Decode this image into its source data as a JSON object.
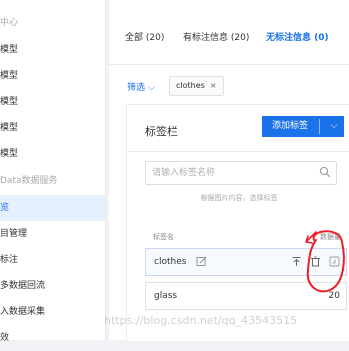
{
  "sidebar": {
    "items": [
      {
        "label": "中心",
        "muted": true
      },
      {
        "label": "模型"
      },
      {
        "label": "模型"
      },
      {
        "label": "模型"
      },
      {
        "label": "模型"
      },
      {
        "label": "模型"
      },
      {
        "label": "Data数据服务",
        "muted": true
      },
      {
        "label": "览",
        "active": true
      },
      {
        "label": "目管理"
      },
      {
        "label": "标注"
      },
      {
        "label": "多数据回流"
      },
      {
        "label": "入数据采集"
      },
      {
        "label": "效"
      }
    ]
  },
  "tabs": [
    {
      "label": "全部 (20)"
    },
    {
      "label": "有标注信息 (20)"
    },
    {
      "label": "无标注信息 (0)",
      "active": true
    }
  ],
  "filter": {
    "toggle_label": "筛选",
    "chip_label": "clothes",
    "chip_close": "×"
  },
  "tag_panel": {
    "title": "标签栏",
    "add_button": "添加标签",
    "add_dropdown": "⌵",
    "search_placeholder": "请输入标签名称",
    "hint": "根据图片内容，选择标签",
    "columns": {
      "name": "标签名",
      "count": "数据量"
    },
    "rows": [
      {
        "name": "clothes",
        "value": "",
        "hovered": true
      },
      {
        "name": "glass",
        "value": "20"
      }
    ]
  },
  "icons": {
    "search": "search-icon",
    "edit": "edit-icon",
    "pin": "pin-top-icon",
    "delete": "trash-icon",
    "shortcut": "shortcut-key-icon"
  },
  "colors": {
    "accent": "#1a73e8",
    "annotation": "#e8212a"
  },
  "watermark": "https://blog.csdn.net/qq_43543515"
}
